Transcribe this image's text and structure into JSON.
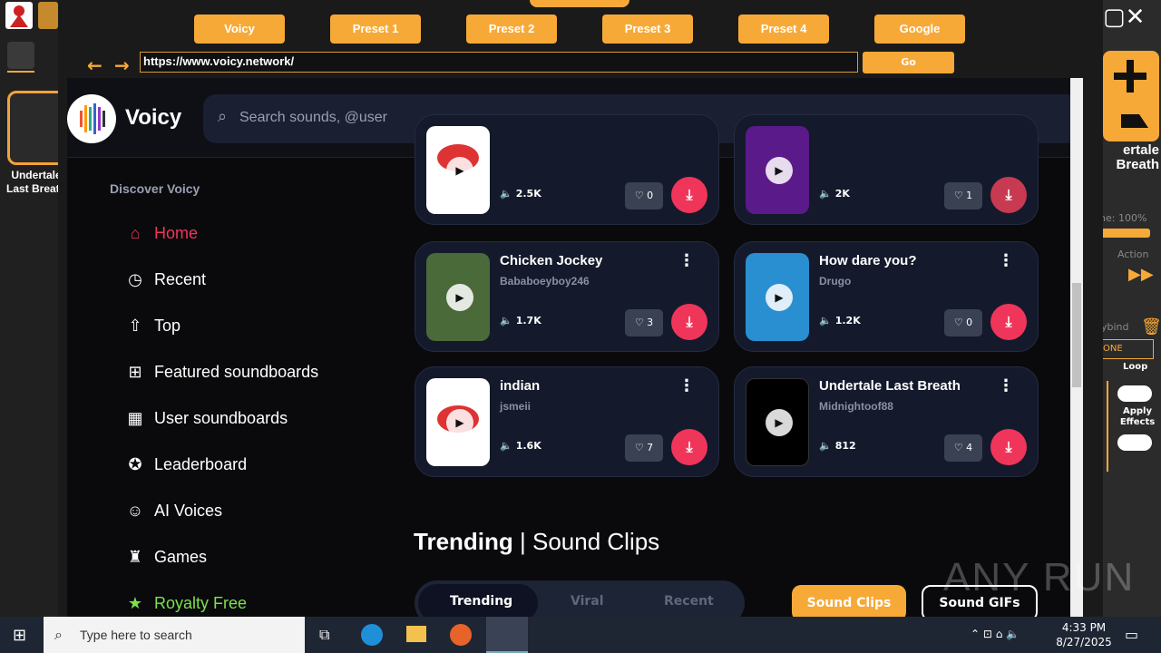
{
  "browser": {
    "presets": [
      "Voicy",
      "Preset 1",
      "Preset 2",
      "Preset 3",
      "Preset 4",
      "Google"
    ],
    "url": "https://www.voicy.network/",
    "go_label": "Go"
  },
  "left_app": {
    "label": "Undertale Last Breath"
  },
  "right_app": {
    "label": "ertale Breath",
    "volume": "ne: 100%",
    "action": "Action",
    "keybind": "ybind",
    "none_btn": "ONE",
    "loop": "Loop",
    "apply_effects": "Apply Effects"
  },
  "site": {
    "logo": "Voicy",
    "search_placeholder": "Search sounds, @user",
    "sidebar_heading": "Discover Voicy",
    "nav": [
      "Home",
      "Recent",
      "Top",
      "Featured soundboards",
      "User soundboards",
      "Leaderboard",
      "AI Voices",
      "Games",
      "Royalty Free"
    ],
    "cards": [
      {
        "title": "",
        "author": "",
        "plays": "2.5K",
        "likes": "0"
      },
      {
        "title": "",
        "author": "",
        "plays": "2K",
        "likes": "1"
      },
      {
        "title": "Chicken Jockey",
        "author": "Bababoeyboy246",
        "plays": "1.7K",
        "likes": "3"
      },
      {
        "title": "How dare you?",
        "author": "Drugo",
        "plays": "1.2K",
        "likes": "0"
      },
      {
        "title": "indian",
        "author": "jsmeii",
        "plays": "1.6K",
        "likes": "7"
      },
      {
        "title": "Undertale Last Breath",
        "author": "Midnightoof88",
        "plays": "812",
        "likes": "4"
      }
    ],
    "section_title_bold": "Trending",
    "section_title_rest": "Sound Clips",
    "tabs": [
      "Trending",
      "Viral",
      "Recent"
    ],
    "sound_clips_btn": "Sound Clips",
    "sound_gifs_btn": "Sound GIFs"
  },
  "taskbar": {
    "search_placeholder": "Type here to search",
    "time": "4:33 PM",
    "date": "8/27/2025"
  },
  "watermark": "ANY RUN",
  "colors": {
    "accent": "#f7a938",
    "download": "#f0355a",
    "home_active": "#f0355a",
    "royalty": "#7ee04b"
  }
}
